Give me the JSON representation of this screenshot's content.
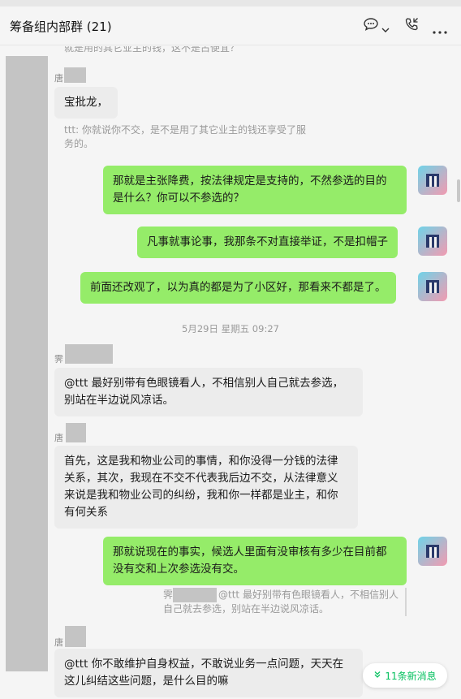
{
  "window": {
    "title": "筹备组内部群 (21)"
  },
  "messages": {
    "top_quote": "就是用的其它业主的钱，这不是占便宜？",
    "m1": {
      "name_prefix": "唐",
      "text": "宝批龙，",
      "quote": "ttt: 你就说你不交，是不是用了其它业主的钱还享受了服务的。"
    },
    "m2": {
      "text": "那就是主张降费，按法律规定是支持的，不然参选的目的是什么？你可以不参选的？"
    },
    "m3": {
      "text": "凡事就事论事，我那条不对直接举证，不是扣帽子"
    },
    "m4": {
      "text": "前面还改观了，以为真的都是为了小区好，那看来不都是了。"
    },
    "timestamp": "5月29日 星期五 09:27",
    "m5": {
      "name_prefix": "霁",
      "text": "@ttt 最好别带有色眼镜看人，不相信别人自己就去参选，别站在半边说风凉话。"
    },
    "m6": {
      "name_prefix": "唐",
      "text": "首先，这是我和物业公司的事情，和你没得一分钱的法律关系，其次，我现在不交不代表我后边不交，从法律意义来说是我和物业公司的纠纷，我和你一样都是业主，和你有何关系"
    },
    "m7": {
      "text": "那就说现在的事实，候选人里面有没审核有多少在目前都没有交和上次参选没有交。",
      "quote_prefix": "霁",
      "quote": "@ttt 最好别带有色眼镜看人，不相信别人自己就去参选，别站在半边说风凉话。"
    },
    "m8": {
      "name_prefix": "唐",
      "text": "@ttt 你不敢维护自身权益，不敢说业务一点问题，天天在这儿纠结这些问题，是什么目的嘛"
    }
  },
  "new_messages": {
    "label": "11条新消息",
    "icon": "double-chevron-down-icon"
  },
  "colors": {
    "my_bubble": "#95ec69",
    "other_bubble": "#ececec",
    "accent": "#07c160"
  }
}
